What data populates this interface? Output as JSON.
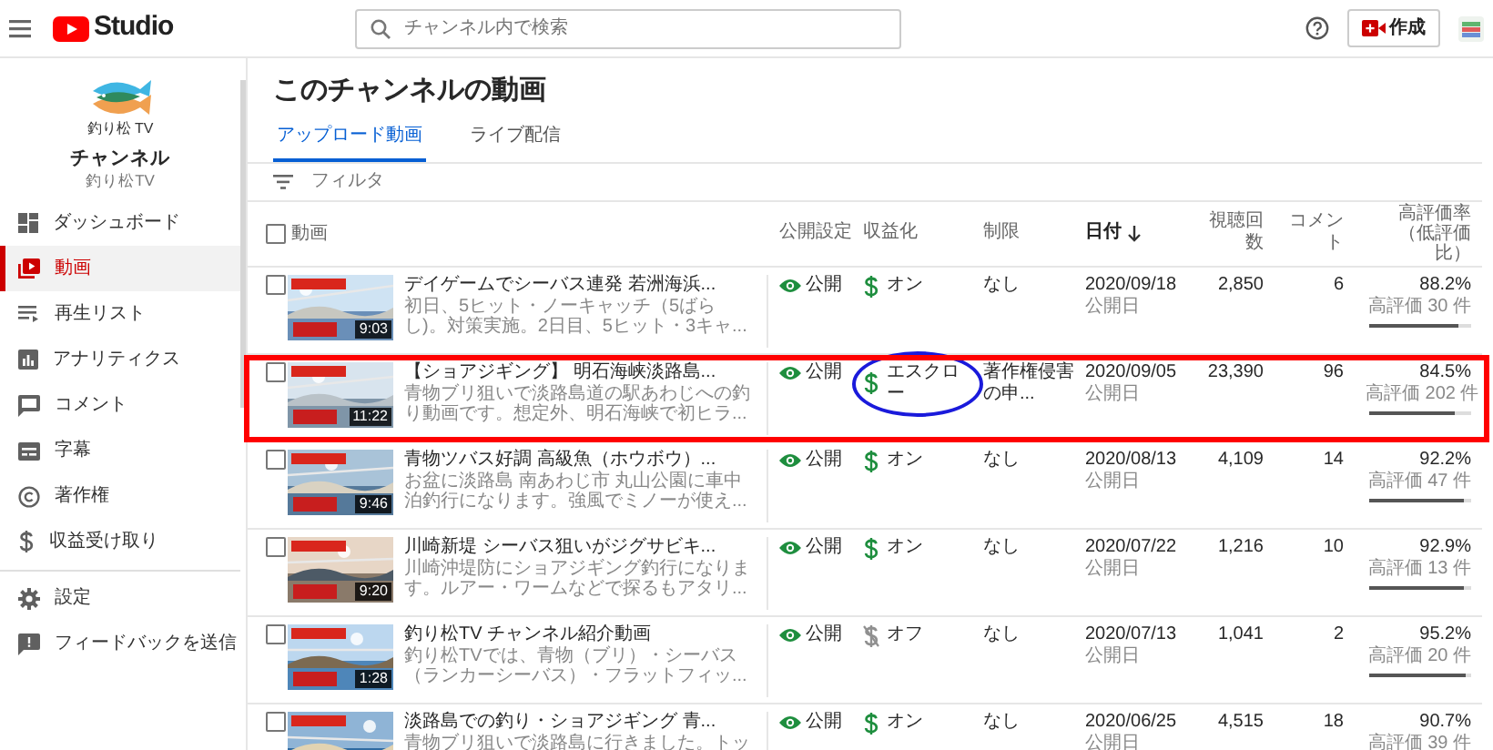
{
  "header": {
    "logo_text": "Studio",
    "search": {
      "placeholder": "チャンネル内で検索"
    },
    "create_button": "作成"
  },
  "sidebar": {
    "logo_text": "釣り松 TV",
    "channel_label": "チャンネル",
    "channel_name": "釣り松TV",
    "items": [
      {
        "label": "ダッシュボード",
        "selected": false
      },
      {
        "label": "動画",
        "selected": true
      },
      {
        "label": "再生リスト",
        "selected": false
      },
      {
        "label": "アナリティクス",
        "selected": false
      },
      {
        "label": "コメント",
        "selected": false
      },
      {
        "label": "字幕",
        "selected": false
      },
      {
        "label": "著作権",
        "selected": false
      },
      {
        "label": "収益受け取り",
        "selected": false
      }
    ],
    "footer_items": [
      {
        "label": "設定"
      },
      {
        "label": "フィードバックを送信"
      }
    ]
  },
  "page_title": "このチャンネルの動画",
  "tabs": [
    {
      "label": "アップロード動画",
      "selected": true
    },
    {
      "label": "ライブ配信",
      "selected": false
    }
  ],
  "filter": {
    "placeholder": "フィルタ"
  },
  "table": {
    "select_all_checked": false,
    "columns": [
      "動画",
      "公開設定",
      "収益化",
      "制限",
      "日付",
      "視聴回数",
      "コメント",
      "高評価率（低評価比）"
    ],
    "rows": [
      {
        "duration": "9:03",
        "title": "デイゲームでシーバス連発 若洲海浜...",
        "checked": false,
        "description": [
          "初日、5ヒット・ノーキャッチ（5ばら",
          "し)。対策実施。2日目、5ヒット・3キャ..."
        ],
        "visibility": "公開",
        "monetization": {
          "kind": "on",
          "label": "オン",
          "circled": false
        },
        "restriction": "なし",
        "date": "2020/09/18",
        "date_note": "公開日",
        "views": "2,850",
        "comments": "6",
        "ratio": "88.2%",
        "likes": "高評価 30 件",
        "level": 0.882,
        "highlighted": false
      },
      {
        "duration": "11:22",
        "title": "【ショアジギング】 明石海峡淡路島...",
        "checked": false,
        "description": [
          "青物ブリ狙いで淡路島道の駅あわじへの釣",
          "り動画です。想定外、明石海峡で初ヒラ..."
        ],
        "visibility": "公開",
        "monetization": {
          "kind": "escrow",
          "label": "エスクロー",
          "circled": true
        },
        "restriction": "著作権侵害の申...",
        "date": "2020/09/05",
        "date_note": "公開日",
        "views": "23,390",
        "comments": "96",
        "ratio": "84.5%",
        "likes": "高評価 202 件",
        "level": 0.845,
        "highlighted": true
      },
      {
        "duration": "9:46",
        "title": "青物ツバス好調 高級魚（ホウボウ）...",
        "checked": false,
        "description": [
          "お盆に淡路島 南あわじ市 丸山公園に車中",
          "泊釣行になります。強風でミノーが使え..."
        ],
        "visibility": "公開",
        "monetization": {
          "kind": "on",
          "label": "オン",
          "circled": false
        },
        "restriction": "なし",
        "date": "2020/08/13",
        "date_note": "公開日",
        "views": "4,109",
        "comments": "14",
        "ratio": "92.2%",
        "likes": "高評価 47 件",
        "level": 0.922,
        "highlighted": false
      },
      {
        "duration": "9:20",
        "title": "川崎新堤 シーバス狙いがジグサビキ...",
        "checked": false,
        "description": [
          "川崎沖堤防にショアジギング釣行になりま",
          "す。ルアー・ワームなどで探るもアタリ..."
        ],
        "visibility": "公開",
        "monetization": {
          "kind": "on",
          "label": "オン",
          "circled": false
        },
        "restriction": "なし",
        "date": "2020/07/22",
        "date_note": "公開日",
        "views": "1,216",
        "comments": "10",
        "ratio": "92.9%",
        "likes": "高評価 13 件",
        "level": 0.929,
        "highlighted": false
      },
      {
        "duration": "1:28",
        "title": "釣り松TV チャンネル紹介動画",
        "checked": false,
        "description": [
          "釣り松TVでは、青物（ブリ）・シーバス",
          "（ランカーシーバス）・フラットフィッ..."
        ],
        "visibility": "公開",
        "monetization": {
          "kind": "off",
          "label": "オフ",
          "circled": false
        },
        "restriction": "なし",
        "date": "2020/07/13",
        "date_note": "公開日",
        "views": "1,041",
        "comments": "2",
        "ratio": "95.2%",
        "likes": "高評価 20 件",
        "level": 0.952,
        "highlighted": false
      },
      {
        "title": "淡路島での釣り・ショアジギング 青...",
        "checked": false,
        "description": [
          "青物ブリ狙いで淡路島に行きました。トッ"
        ],
        "visibility": "公開",
        "monetization": {
          "kind": "on",
          "label": "オン",
          "circled": false
        },
        "restriction": "なし",
        "date": "2020/06/25",
        "date_note": "公開日",
        "views": "4,515",
        "comments": "18",
        "ratio": "90.7%",
        "likes": "高評価 39 件",
        "highlighted": false
      }
    ]
  }
}
